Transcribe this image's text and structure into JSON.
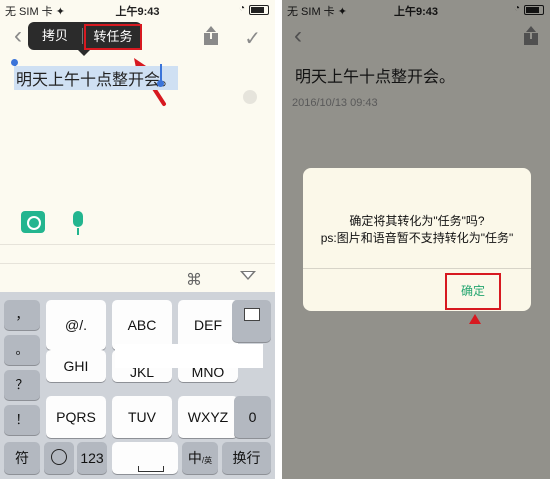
{
  "colors": {
    "accent_green": "#23b58f",
    "highlight_red": "#d71920",
    "selection": "#cfe0f3",
    "paper": "#fcfaf0"
  },
  "left": {
    "status": {
      "carrier": "无 SIM 卡 ✦",
      "time": "上午9:43",
      "lock": "◔"
    },
    "popup": {
      "copy": "拷贝",
      "to_task": "转任务"
    },
    "note_text": "明天上午十点整开会。",
    "icons": {
      "back": "chevron-left-icon",
      "share": "share-icon",
      "check": "check-icon",
      "camera": "camera-icon",
      "mic": "microphone-icon",
      "command": "command-icon",
      "hide_keyboard": "triangle-down-icon"
    },
    "command_glyph": "⌘",
    "keyboard": {
      "side_keys": [
        "，",
        "。",
        "？",
        "！"
      ],
      "row1": [
        "@/.",
        "ABC",
        "DEF"
      ],
      "row2": [
        "GHI",
        "JKL",
        "MNO"
      ],
      "row3": [
        "PQRS",
        "TUV",
        "WXYZ",
        "0"
      ],
      "bottom": {
        "symbols": "符",
        "numbers": "123",
        "zh": "中",
        "zh_sub": "/英",
        "return": "换行"
      }
    }
  },
  "right": {
    "status": {
      "carrier": "无 SIM 卡 ✦",
      "time": "上午9:43",
      "lock": "◔"
    },
    "note_title": "明天上午十点整开会。",
    "date": "2016/10/13 09:43",
    "dialog": {
      "line1": "确定将其转化为\"任务\"吗?",
      "line2": "ps:图片和语音暂不支持转化为\"任务\"",
      "confirm": "确定"
    }
  }
}
